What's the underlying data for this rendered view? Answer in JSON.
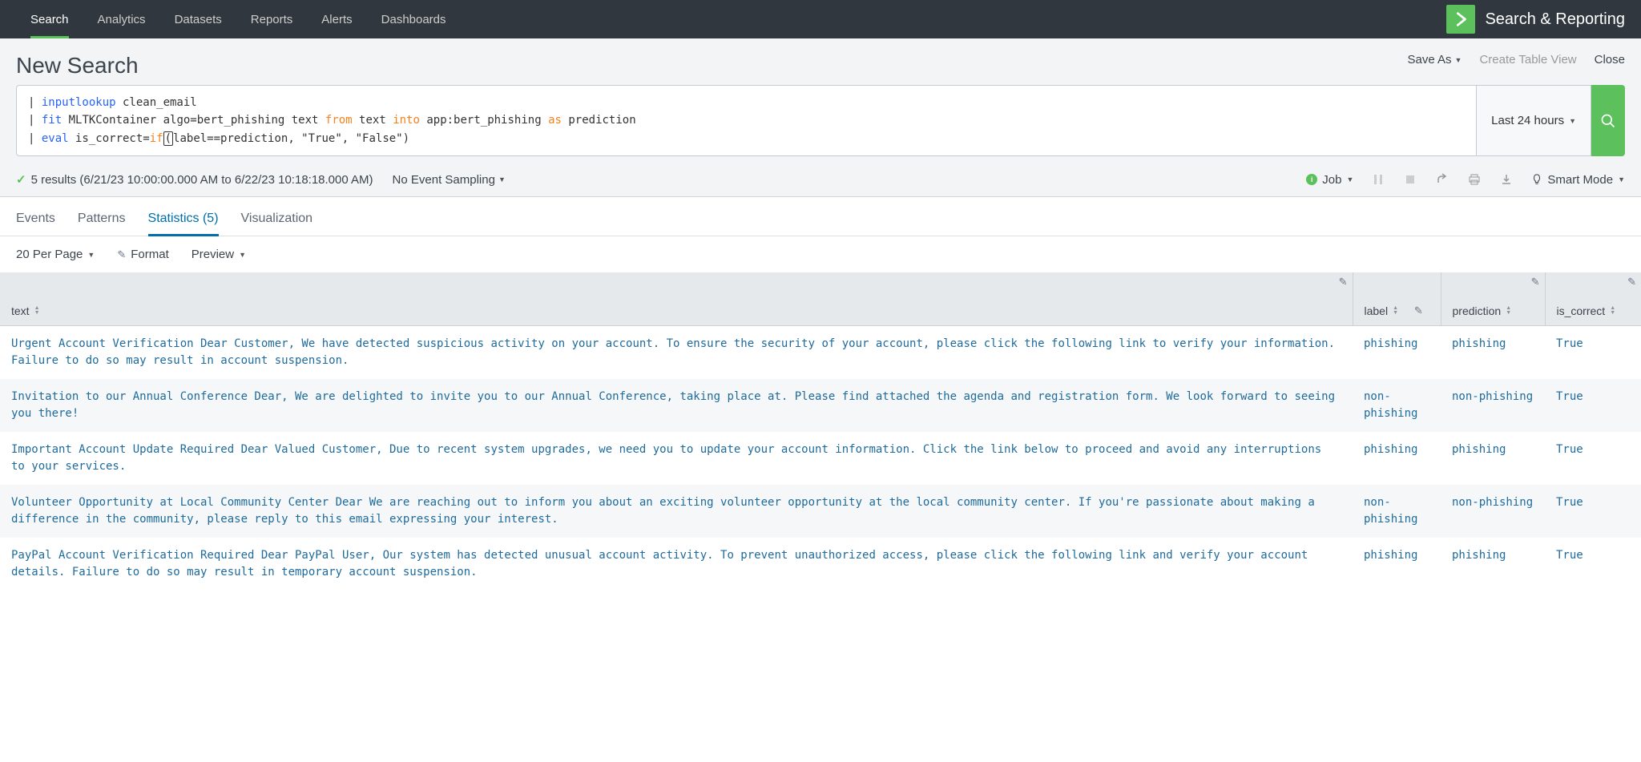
{
  "nav": {
    "items": [
      {
        "label": "Search",
        "active": true
      },
      {
        "label": "Analytics",
        "active": false
      },
      {
        "label": "Datasets",
        "active": false
      },
      {
        "label": "Reports",
        "active": false
      },
      {
        "label": "Alerts",
        "active": false
      },
      {
        "label": "Dashboards",
        "active": false
      }
    ],
    "app_title": "Search & Reporting"
  },
  "header": {
    "title": "New Search",
    "actions": {
      "save_as": "Save As",
      "create_table": "Create Table View",
      "close": "Close"
    }
  },
  "search": {
    "query_tokens": [
      [
        {
          "t": "pipe",
          "v": "| "
        },
        {
          "t": "kw-blue",
          "v": "inputlookup"
        },
        {
          "t": "ident",
          "v": " clean_email"
        }
      ],
      [
        {
          "t": "pipe",
          "v": "| "
        },
        {
          "t": "kw-blue",
          "v": "fit"
        },
        {
          "t": "ident",
          "v": " MLTKContainer algo=bert_phishing text "
        },
        {
          "t": "kw-orange",
          "v": "from"
        },
        {
          "t": "ident",
          "v": " text "
        },
        {
          "t": "kw-orange",
          "v": "into"
        },
        {
          "t": "ident",
          "v": " app:bert_phishing "
        },
        {
          "t": "kw-orange",
          "v": "as"
        },
        {
          "t": "ident",
          "v": " prediction"
        }
      ],
      [
        {
          "t": "pipe",
          "v": "| "
        },
        {
          "t": "kw-blue",
          "v": "eval"
        },
        {
          "t": "ident",
          "v": " is_correct="
        },
        {
          "t": "kw-orange",
          "v": "if"
        },
        {
          "t": "paren-hl",
          "v": "("
        },
        {
          "t": "ident",
          "v": "label==prediction, \"True\", \"False\")"
        }
      ]
    ],
    "time_range": "Last 24 hours"
  },
  "results_bar": {
    "count_text": "5 results (6/21/23 10:00:00.000 AM to 6/22/23 10:18:18.000 AM)",
    "sampling": "No Event Sampling",
    "job_label": "Job",
    "smart_mode": "Smart Mode"
  },
  "tabs": [
    {
      "label": "Events",
      "active": false
    },
    {
      "label": "Patterns",
      "active": false
    },
    {
      "label": "Statistics (5)",
      "active": true
    },
    {
      "label": "Visualization",
      "active": false
    }
  ],
  "table_controls": {
    "per_page": "20 Per Page",
    "format": "Format",
    "preview": "Preview"
  },
  "table": {
    "columns": [
      "text",
      "label",
      "prediction",
      "is_correct"
    ],
    "rows": [
      {
        "text": "Urgent Account Verification Dear Customer, We have detected suspicious activity on your account. To ensure the security of your account, please click the following link to verify your information. Failure to do so may result in account suspension.",
        "label": "phishing",
        "prediction": "phishing",
        "is_correct": "True"
      },
      {
        "text": "Invitation to our Annual Conference Dear, We are delighted to invite you to our Annual Conference, taking place at. Please find attached the agenda and registration form. We look forward to seeing you there!",
        "label": "non-phishing",
        "prediction": "non-phishing",
        "is_correct": "True"
      },
      {
        "text": "Important Account Update Required Dear Valued Customer, Due to recent system upgrades, we need you to update your account information. Click the link below to proceed and avoid any interruptions to your services.",
        "label": "phishing",
        "prediction": "phishing",
        "is_correct": "True"
      },
      {
        "text": "Volunteer Opportunity at Local Community Center Dear We are reaching out to inform you about an exciting volunteer opportunity at the local community center. If you're passionate about making a difference in the community, please reply to this email expressing your interest.",
        "label": "non-phishing",
        "prediction": "non-phishing",
        "is_correct": "True"
      },
      {
        "text": "PayPal Account Verification Required Dear PayPal User, Our system has detected unusual account activity. To prevent unauthorized access, please click the following link and verify your account details. Failure to do so may result in temporary account suspension.",
        "label": "phishing",
        "prediction": "phishing",
        "is_correct": "True"
      }
    ]
  }
}
